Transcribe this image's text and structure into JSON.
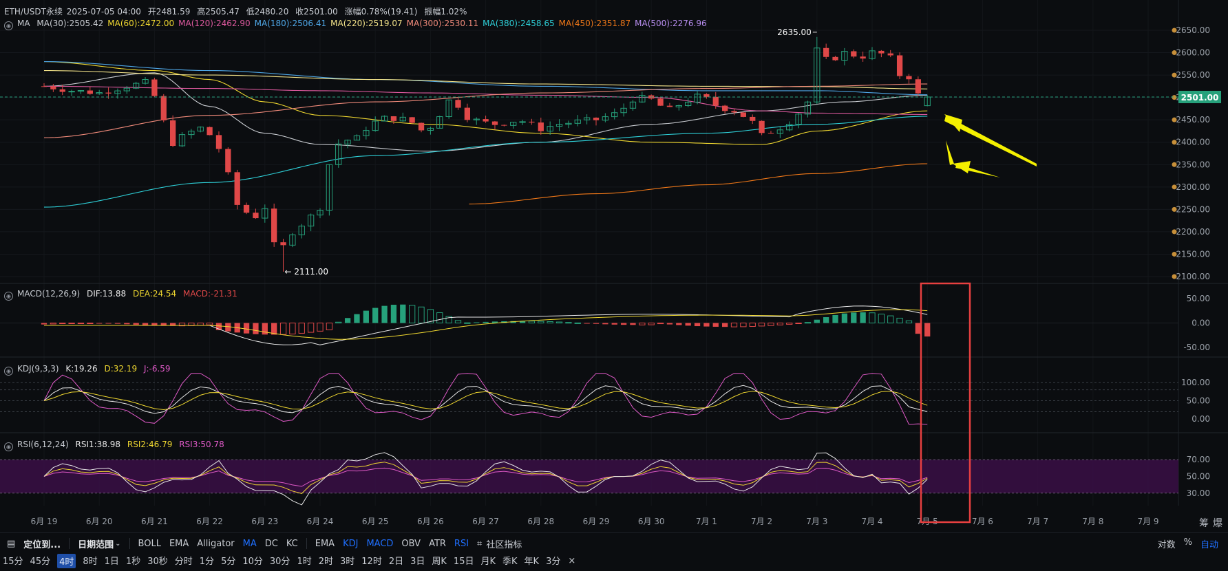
{
  "header": {
    "symbol": "ETH/USDT永续",
    "datetime": "2025-07-05 04:00",
    "open_label": "开",
    "open": "2481.59",
    "high_label": "高",
    "high": "2505.47",
    "low_label": "低",
    "low": "2480.20",
    "close_label": "收",
    "close": "2501.00",
    "change_label": "涨幅",
    "change": "0.78%(19.41)",
    "amp_label": "振幅",
    "amp": "1.02%"
  },
  "ma_legend": {
    "title": "MA",
    "items": [
      {
        "text": "MA(30):2505.42",
        "color": "#c9ccd1"
      },
      {
        "text": "MA(60):2472.00",
        "color": "#f0d830"
      },
      {
        "text": "MA(120):2462.90",
        "color": "#e05aa0"
      },
      {
        "text": "MA(180):2506.41",
        "color": "#4fa8e8"
      },
      {
        "text": "MA(220):2519.07",
        "color": "#f4e48a"
      },
      {
        "text": "MA(300):2530.11",
        "color": "#f08a7a"
      },
      {
        "text": "MA(380):2458.65",
        "color": "#2ed0d8"
      },
      {
        "text": "MA(450):2351.87",
        "color": "#f07818"
      },
      {
        "text": "MA(500):2276.96",
        "color": "#b88ef0"
      }
    ]
  },
  "macd_legend": {
    "title": "MACD(12,26,9)",
    "dif": "DIF:13.88",
    "dea": "DEA:24.54",
    "macd": "MACD:-21.31"
  },
  "kdj_legend": {
    "title": "KDJ(9,3,3)",
    "k": "K:19.26",
    "d": "D:32.19",
    "j": "J:-6.59"
  },
  "rsi_legend": {
    "title": "RSI(6,12,24)",
    "r1": "RSI1:38.98",
    "r2": "RSI2:46.79",
    "r3": "RSI3:50.78"
  },
  "colors": {
    "up": "#26a17b",
    "down": "#e04848",
    "bg": "#0b0d10",
    "price_tag": "#26a17b",
    "box": "#e84040",
    "arrow": "#f4f000"
  },
  "chart_data": [
    {
      "type": "candlestick",
      "price_axis": [
        2650,
        2600,
        2550,
        2500,
        2450,
        2400,
        2350,
        2300,
        2250,
        2200,
        2150,
        2100
      ],
      "price_axis_labels": [
        "2650.00",
        "2600.00",
        "2550.00",
        "2500.00",
        "2450.00",
        "2400.00",
        "2350.00",
        "2300.00",
        "2250.00",
        "2200.00",
        "2150.00",
        "2100.00"
      ],
      "ylim": [
        2085,
        2670
      ],
      "last_price": 2501.0,
      "last_price_label": "2501.00",
      "high_marker": {
        "value": 2635.0,
        "label": "2635.00"
      },
      "low_marker": {
        "value": 2111.0,
        "label": "← 2111.00"
      },
      "x_labels": [
        "6月 19",
        "6月 20",
        "6月 21",
        "6月 22",
        "6月 23",
        "6月 24",
        "6月 25",
        "6月 26",
        "6月 27",
        "6月 28",
        "6月 29",
        "6月 30",
        "7月 1",
        "7月 2",
        "7月 3",
        "7月 4",
        "7月 5",
        "7月 6",
        "7月 7",
        "7月 8",
        "7月 9"
      ],
      "ma_series": [
        {
          "name": "MA(30)",
          "color": "#c9ccd1"
        },
        {
          "name": "MA(60)",
          "color": "#f0d830"
        },
        {
          "name": "MA(120)",
          "color": "#e05aa0"
        },
        {
          "name": "MA(180)",
          "color": "#4fa8e8"
        },
        {
          "name": "MA(220)",
          "color": "#f4e48a"
        },
        {
          "name": "MA(300)",
          "color": "#f08a7a"
        },
        {
          "name": "MA(380)",
          "color": "#2ed0d8"
        },
        {
          "name": "MA(450)",
          "color": "#f07818"
        }
      ]
    },
    {
      "type": "bar",
      "name": "MACD",
      "axis": [
        50,
        0,
        -50
      ],
      "axis_labels": [
        "50.00",
        "0.00",
        "-50.00"
      ],
      "ylim": [
        -70,
        70
      ]
    },
    {
      "type": "line",
      "name": "KDJ",
      "axis": [
        100,
        50,
        0
      ],
      "axis_labels": [
        "100.00",
        "50.00",
        "0.00"
      ],
      "ylim": [
        -30,
        130
      ],
      "reference_lines": [
        100,
        80,
        50,
        20
      ]
    },
    {
      "type": "line",
      "name": "RSI",
      "axis": [
        70,
        50,
        30
      ],
      "axis_labels": [
        "70.00",
        "50.00",
        "30.00"
      ],
      "ylim": [
        15,
        85
      ],
      "band": [
        30,
        70
      ]
    }
  ],
  "toolbar1": {
    "locate": "定位到...",
    "date_range": "日期范围",
    "main_indicators": [
      "BOLL",
      "EMA",
      "Alligator",
      "MA",
      "DC",
      "KC"
    ],
    "sub_indicators": [
      "EMA",
      "KDJ",
      "MACD",
      "OBV",
      "ATR",
      "RSI"
    ],
    "community": "社区指标",
    "right": [
      "对数",
      "%",
      "自动"
    ]
  },
  "toolbar2": {
    "intervals": [
      "15分",
      "45分",
      "4时",
      "8时",
      "1日",
      "1秒",
      "30秒",
      "分时",
      "1分",
      "5分",
      "10分",
      "30分",
      "1时",
      "2时",
      "3时",
      "12时",
      "2日",
      "3日",
      "周K",
      "15日",
      "月K",
      "季K",
      "年K",
      "3分"
    ],
    "close": "×"
  },
  "side": {
    "chou": "筹",
    "bao": "爆"
  }
}
